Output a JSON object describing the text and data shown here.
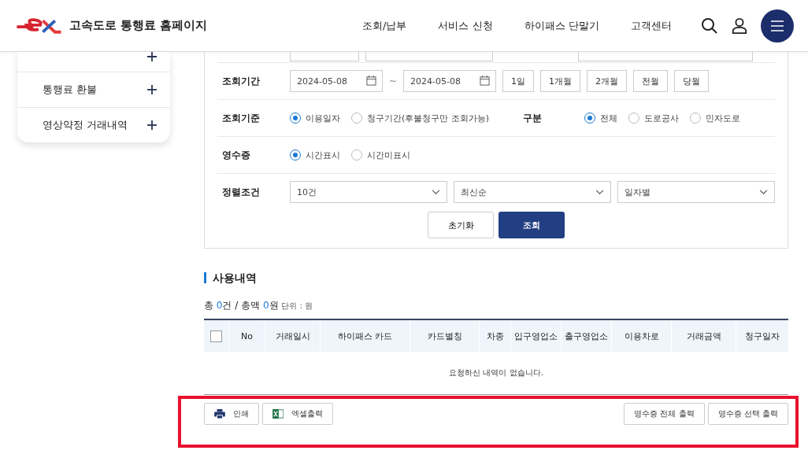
{
  "header": {
    "site_title": "고속도로 통행료 홈페이지",
    "nav": [
      "조회/납부",
      "서비스 신청",
      "하이패스 단말기",
      "고객센터"
    ]
  },
  "sidebar": {
    "items": [
      {
        "label": "통행료 환불",
        "expanded": false
      },
      {
        "label": "영상약정 거래내역",
        "expanded": false
      }
    ]
  },
  "form": {
    "period": {
      "label": "조회기간",
      "from": "2024-05-08",
      "separator": "~",
      "to": "2024-05-08",
      "quick_buttons": [
        "1일",
        "1개월",
        "2개월",
        "전월",
        "당월"
      ]
    },
    "criteria": {
      "label": "조회기준",
      "options": [
        {
          "label": "이용일자",
          "selected": true
        },
        {
          "label": "청구기간(후불청구만 조회가능)",
          "selected": false
        }
      ],
      "division_label": "구분",
      "division_options": [
        {
          "label": "전체",
          "selected": true
        },
        {
          "label": "도로공사",
          "selected": false
        },
        {
          "label": "민자도로",
          "selected": false
        }
      ]
    },
    "receipt": {
      "label": "영수증",
      "options": [
        {
          "label": "시간표시",
          "selected": true
        },
        {
          "label": "시간미표시",
          "selected": false
        }
      ]
    },
    "sort": {
      "label": "정렬조건",
      "selects": [
        "10건",
        "최신순",
        "일자별"
      ]
    },
    "buttons": {
      "reset": "초기화",
      "search": "조회"
    }
  },
  "results": {
    "title": "사용내역",
    "summary": {
      "count_label": "총",
      "count": "0",
      "count_unit": "건",
      "amount_label": "/ 총액",
      "amount": "0",
      "amount_unit": "원",
      "unit_note": "단위 : 원"
    },
    "table": {
      "select_all_checked": false,
      "columns": [
        "No",
        "거래일시",
        "하이패스 카드",
        "카드별칭",
        "차종",
        "입구영업소",
        "출구영업소",
        "이용차로",
        "거래금액",
        "청구일자"
      ],
      "empty_message": "요청하신 내역이 없습니다."
    },
    "actions_left": [
      {
        "kind": "print",
        "label": "인쇄"
      },
      {
        "kind": "excel",
        "label": "엑셀출력"
      }
    ],
    "actions_right": [
      "영수증 전체 출력",
      "영수증 선택 출력"
    ]
  }
}
